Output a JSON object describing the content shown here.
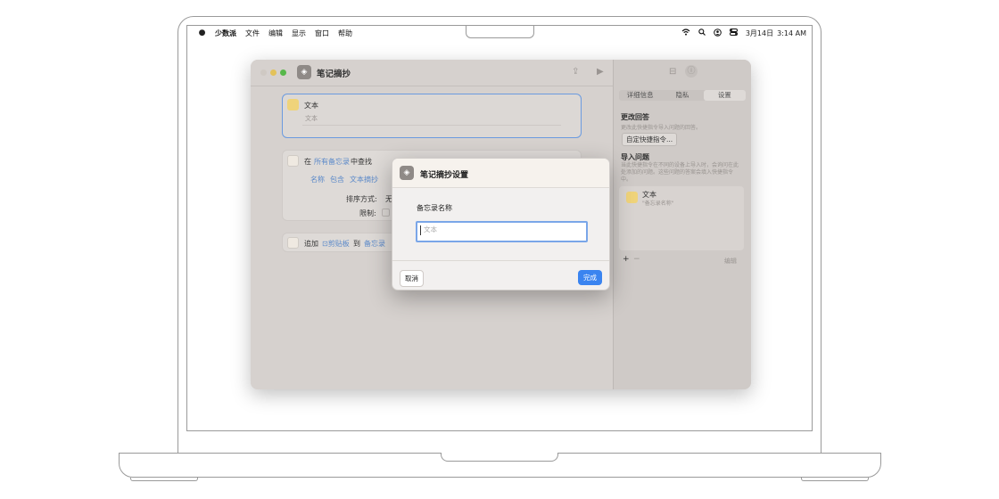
{
  "menubar": {
    "app_name": "少数派",
    "items": [
      "文件",
      "编辑",
      "显示",
      "窗口",
      "帮助"
    ],
    "wifi_icon": "wifi-icon",
    "search_icon": "search-icon",
    "user_icon": "user-icon",
    "control_icon": "control-center-icon",
    "date": "3月14日",
    "time": "3:14 AM"
  },
  "window": {
    "title": "笔记摘抄",
    "text_action": {
      "title": "文本",
      "placeholder": "文本"
    },
    "find_action": {
      "prefix": "在",
      "scope": "所有备忘录",
      "suffix": "中查找",
      "filter_name": "名称",
      "filter_op": "包含",
      "filter_value": "文本摘抄",
      "sort_label": "排序方式:",
      "sort_value": "无",
      "limit_label": "限制:"
    },
    "append_action": {
      "prefix": "追加",
      "content": "剪贴板",
      "middle": "到",
      "target": "备忘录"
    }
  },
  "sidebar": {
    "tabs": [
      "详细信息",
      "隐私",
      "设置"
    ],
    "selected_tab": "设置",
    "change_answer_title": "更改回答",
    "change_answer_desc": "更改此快捷指令导入问题的回答。",
    "customize_button": "自定快捷指令...",
    "import_questions_title": "导入问题",
    "import_questions_desc": "当此快捷指令在不同的设备上导入时，会询问在此处添加的问题。这些问题的答案会填入快捷指令中。",
    "question_item_title": "文本",
    "question_item_sub": "\"备忘录名称\"",
    "add_label": "+",
    "remove_label": "−",
    "edit_label": "编辑"
  },
  "dialog": {
    "title": "笔记摘抄设置",
    "field_label": "备忘录名称",
    "field_placeholder": "文本",
    "cancel_label": "取消",
    "done_label": "完成"
  }
}
